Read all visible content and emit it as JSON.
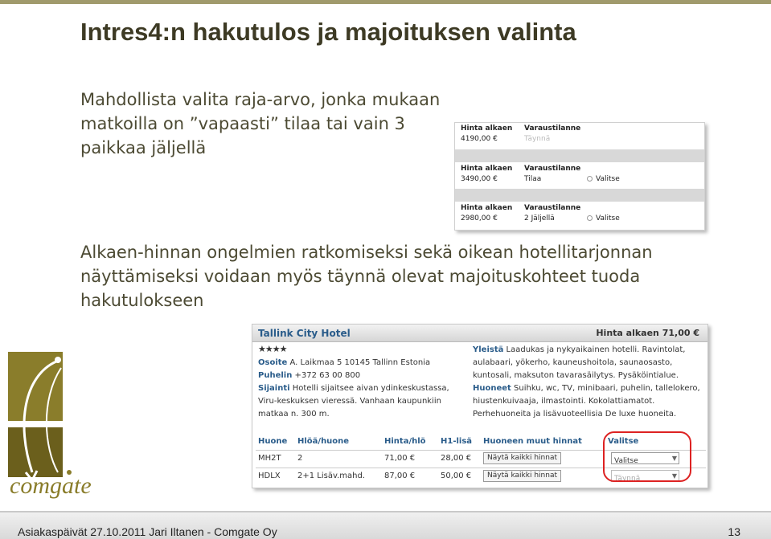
{
  "slide": {
    "title": "Intres4:n hakutulos ja majoituksen valinta",
    "para1": "Mahdollista valita raja-arvo, jonka mukaan matkoilla on ”vapaasti” tilaa tai vain 3 paikkaa jäljellä",
    "para2": "Alkaen-hinnan ongelmien ratkomiseksi sekä oikean hotellitarjonnan näyttämiseksi voidaan myös täynnä olevat majoituskohteet tuoda hakutulokseen"
  },
  "availability": {
    "col_price": "Hinta alkaen",
    "col_status": "Varaustilanne",
    "rows": [
      {
        "price": "4190,00 €",
        "status": "Täynnä",
        "select": ""
      },
      {
        "price": "3490,00 €",
        "status": "Tilaa",
        "select": "Valitse"
      },
      {
        "price": "2980,00 €",
        "status": "2 Jäljellä",
        "select": "Valitse"
      }
    ]
  },
  "hotel": {
    "name": "Tallink City Hotel",
    "price_from": "Hinta alkaen 71,00 €",
    "stars": "★★★★",
    "address_label": "Osoite",
    "address": "A. Laikmaa 5 10145 Tallinn Estonia",
    "phone_label": "Puhelin",
    "phone": "+372 63 00 800",
    "location_label": "Sijainti",
    "location": "Hotelli sijaitsee aivan ydinkeskustassa, Viru-keskuksen vieressä. Vanhaan kaupunkiin matkaa n. 300 m.",
    "general_label": "Yleistä",
    "general": "Laadukas ja nykyaikainen hotelli. Ravintolat, aulabaari, yökerho, kauneushoitola, saunaosasto, kuntosali, maksuton tavarasäilytys. Pysäköintialue.",
    "rooms_label": "Huoneet",
    "rooms": "Suihku, wc, TV, minibaari, puhelin, tallelokero, hiustenkuivaaja, ilmastointi. Kokolattiamatot. Perhehuoneita ja lisävuoteellisia De luxe huoneita.",
    "table_headers": [
      "Huone",
      "Hlöä/huone",
      "Hinta/hlö",
      "H1-lisä",
      "Huoneen muut hinnat",
      "Valitse"
    ],
    "table_rows": [
      {
        "room": "MH2T",
        "persons": "2",
        "price": "71,00 €",
        "extra": "28,00 €",
        "button": "Näytä kaikki hinnat",
        "select": "Valitse"
      },
      {
        "room": "HDLX",
        "persons": "2+1 Lisäv.mahd.",
        "price": "87,00 €",
        "extra": "50,00 €",
        "button": "Näytä kaikki hinnat",
        "select": "Täynnä"
      }
    ]
  },
  "logo": {
    "text": "comgate"
  },
  "footer": {
    "text": "Asiakaspäivät 27.10.2011 Jari Iltanen - Comgate Oy",
    "page": "13"
  },
  "colors": {
    "title": "#3d3a24",
    "body": "#4c4a33",
    "logo_brown": "#8a7d2b",
    "highlight_red": "#d22222"
  }
}
